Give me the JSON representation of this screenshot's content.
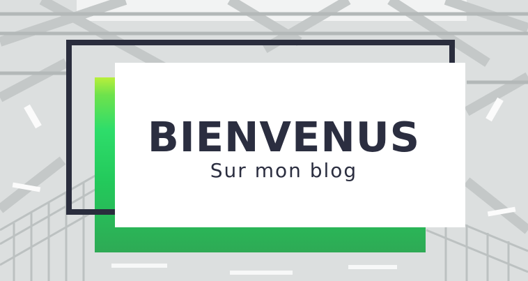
{
  "banner": {
    "title": "BIENVENUS",
    "subtitle": "Sur mon blog"
  },
  "colors": {
    "frame": "#2a2d3d",
    "accent_green": "#2edd6a",
    "accent_lime": "#b8ef3b",
    "card": "#ffffff",
    "text": "#2b2e40"
  }
}
